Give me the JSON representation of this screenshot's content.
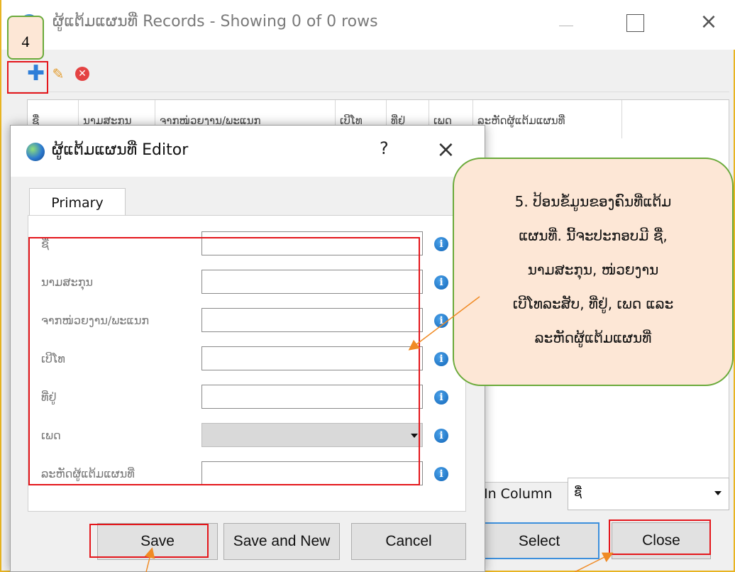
{
  "main_window": {
    "title": "ຜູ້ແຕ້ມແຜນທີ່ Records - Showing 0 of 0 rows",
    "columns": [
      "ຊື່",
      "ນາມສະກຸນ",
      "ຈາກໜ່ວຍງານ/ພະແນກ",
      "ເບີໂທ",
      "ທີ່ຢູ່",
      "ເພດ",
      "ລະຫັດຜູ້ແຕ້ມແຜນທີ່"
    ],
    "filter_label": "In Column",
    "filter_value": "ຊື່",
    "select_label": "Select",
    "close_label": "Close"
  },
  "editor": {
    "title": "ຜູ້ແຕ້ມແຜນທີ່ Editor",
    "help_symbol": "?",
    "close_symbol": "×",
    "tab": "Primary",
    "fields": [
      {
        "label": "ຊື່"
      },
      {
        "label": "ນາມສະກຸນ"
      },
      {
        "label": "ຈາກໜ່ວຍງານ/ພະແນກ"
      },
      {
        "label": "ເບີໂທ"
      },
      {
        "label": "ທີ່ຢູ່"
      },
      {
        "label": "ເພດ"
      },
      {
        "label": "ລະຫັດຜູ້ແຕ້ມແຜນທີ່"
      }
    ],
    "buttons": {
      "save": "Save",
      "save_and_new": "Save and New",
      "cancel": "Cancel"
    }
  },
  "annotations": {
    "step4": "4",
    "callout5_lines": [
      "5. ປ້ອນຂໍ້ມູນຂອງຄົນທີ່ແຕ້ມ",
      "ແຜນທີ່. ນີ້ຈະປະກອບມີ ຊື່,",
      "ນາມສະກຸນ, ໜ່ວຍງານ",
      "ເບີໂທລະສັບ, ທີ່ຢູ່, ເພດ ແລະ",
      "ລະຫັດຜູ້ແຕ້ມແຜນທີ່"
    ],
    "highlight_color": "#e4161b",
    "arrow_color": "#f08a24",
    "callout_fill": "#fde7d6",
    "callout_border": "#6aaa3a"
  },
  "icons": {
    "add": "plus-icon",
    "edit": "pencil-icon",
    "delete": "delete-icon",
    "info": "info-icon",
    "app": "globe-icon"
  }
}
